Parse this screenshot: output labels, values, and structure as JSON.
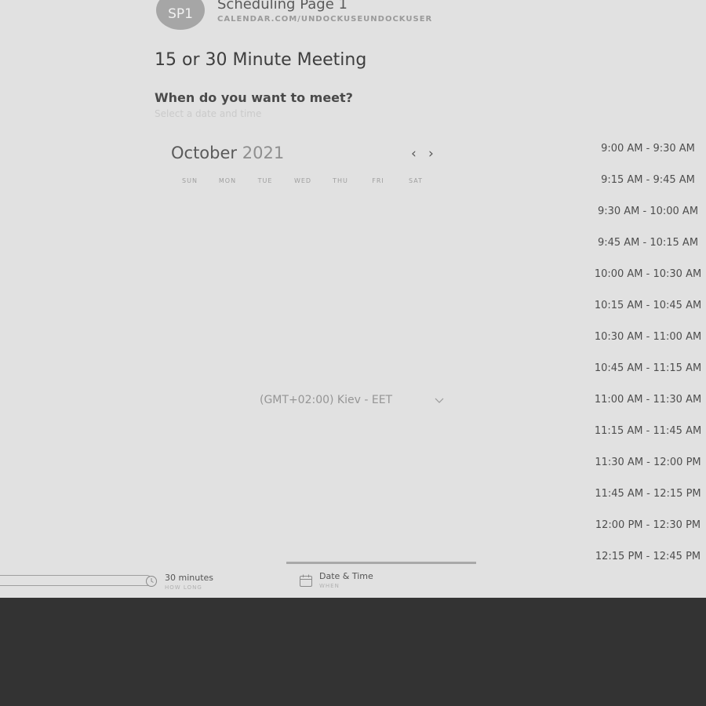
{
  "header": {
    "avatar_initials": "SP1",
    "page_name": "Scheduling Page 1",
    "page_url": "CALENDAR.COM/UNDOCKUSEUNDOCKUSER"
  },
  "meeting": {
    "title": "15 or 30 Minute Meeting",
    "question": "When do you want to meet?",
    "hint": "Select a date and time"
  },
  "calendar": {
    "month": "October",
    "year": "2021",
    "prev_icon": "‹",
    "next_icon": "›",
    "weekdays": [
      "SUN",
      "MON",
      "TUE",
      "WED",
      "THU",
      "FRI",
      "SAT"
    ]
  },
  "timezone": {
    "value": "(GMT+02:00) Kiev - EET"
  },
  "time_slots": [
    "9:00 AM - 9:30 AM",
    "9:15 AM - 9:45 AM",
    "9:30 AM - 10:00 AM",
    "9:45 AM - 10:15 AM",
    "10:00 AM - 10:30 AM",
    "10:15 AM - 10:45 AM",
    "10:30 AM - 11:00 AM",
    "10:45 AM - 11:15 AM",
    "11:00 AM - 11:30 AM",
    "11:15 AM - 11:45 AM",
    "11:30 AM - 12:00 PM",
    "11:45 AM - 12:15 PM",
    "12:00 PM - 12:30 PM",
    "12:15 PM - 12:45 PM"
  ],
  "steps": {
    "duration": {
      "label": "30 minutes",
      "sub": "HOW LONG"
    },
    "datetime": {
      "label": "Date & Time",
      "sub": "WHEN"
    }
  }
}
